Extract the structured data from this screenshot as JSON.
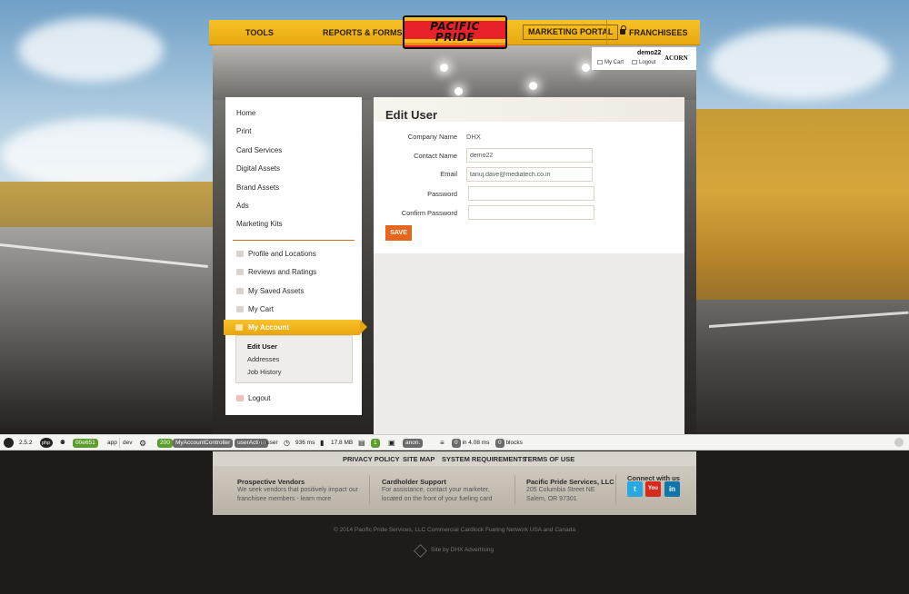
{
  "nav": {
    "tools": "TOOLS",
    "reports": "REPORTS & FORMS",
    "logo_line1": "PACIFIC",
    "logo_line2": "PRIDE",
    "portal": "MARKETING PORTAL",
    "franchisees": "FRANCHISEES"
  },
  "userbox": {
    "username": "demo22",
    "cart": "My Cart",
    "logout": "Logout",
    "brand": "ACORN"
  },
  "sidebar": {
    "links": [
      "Home",
      "Print",
      "Card Services",
      "Digital Assets",
      "Brand Assets",
      "Ads",
      "Marketing Kits"
    ],
    "account_links": [
      "Profile and Locations",
      "Reviews and Ratings",
      "My Saved Assets",
      "My Cart"
    ],
    "active": "My Account",
    "submenu": [
      "Edit User",
      "Addresses",
      "Job History"
    ],
    "logout": "Logout"
  },
  "form": {
    "title": "Edit User",
    "company_label": "Company Name",
    "company_value": "DHX",
    "contact_label": "Contact Name",
    "contact_value": "demo22",
    "email_label": "Email",
    "email_value": "tanuj.dave@mediatech.co.in",
    "password_label": "Password",
    "password_value": "",
    "confirm_label": "Confirm Password",
    "confirm_value": "",
    "save": "SAVE"
  },
  "debugbar": {
    "version": "2.5.2",
    "php": "php",
    "token": "00e651",
    "app": "app",
    "env": "dev",
    "status": "200",
    "controller": "MyAccountController",
    "action": "userAction",
    "on": "on user",
    "time": "936 ms",
    "memory": "17.8 MB",
    "forms": "1",
    "user": "anon.",
    "queries": "0",
    "query_time": "in 4.08 ms",
    "blocks_count": "0",
    "blocks": "blocks"
  },
  "footer": {
    "links": [
      "PRIVACY POLICY",
      "SITE MAP",
      "SYSTEM REQUIREMENTS",
      "TERMS OF USE"
    ],
    "vendors_title": "Prospective Vendors",
    "vendors_text1": "We seek vendors that positively impact our",
    "vendors_text2": "franchisee members - learn more",
    "support_title": "Cardholder Support",
    "support_text1": "For assistance, contact your marketer,",
    "support_text2": "located on the front of your fueling card",
    "company_title": "Pacific Pride Services, LLC",
    "company_addr1": "205 Columbia Street NE",
    "company_addr2": "Salem, OR 97301",
    "connect": "Connect with us",
    "copyright": "© 2014 Pacific Pride Services, LLC    Commercial Cardlock Fueling Network    USA and Canada",
    "site_by": "Site by DHX Advertising"
  },
  "colors": {
    "accent_yellow": "#f2b51c",
    "accent_orange": "#e8661b",
    "logo_red": "#e8212a"
  }
}
